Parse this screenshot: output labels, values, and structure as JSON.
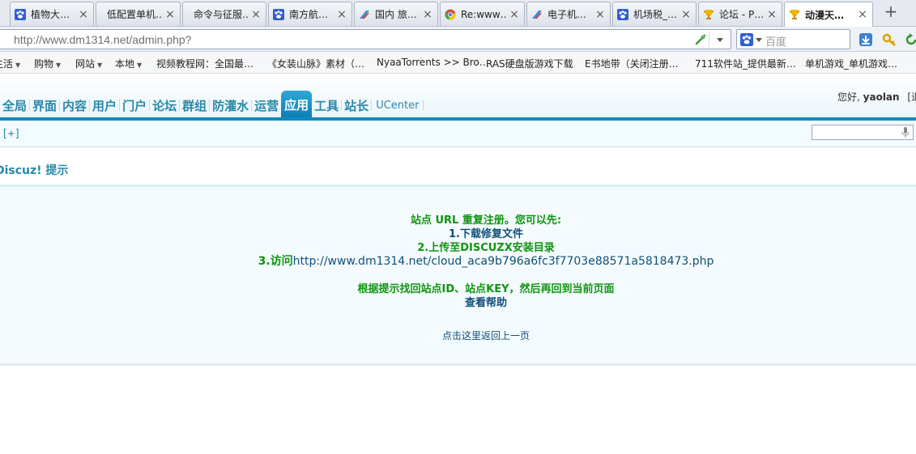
{
  "browser": {
    "tabs": [
      {
        "label": "植物大…",
        "icon": "baidu-paw-icon",
        "active": false
      },
      {
        "label": "低配置单机…",
        "icon": "blank-page-icon",
        "active": false
      },
      {
        "label": "命令与征服…",
        "icon": "blank-page-icon",
        "active": false
      },
      {
        "label": "南方航…",
        "icon": "baidu-paw-icon",
        "active": false
      },
      {
        "label": "国内 旅…",
        "icon": "airline-icon",
        "active": false
      },
      {
        "label": "Re:www…",
        "icon": "chrome-icon",
        "active": false
      },
      {
        "label": "电子机…",
        "icon": "airline-icon",
        "active": false
      },
      {
        "label": "机场税_…",
        "icon": "baidu-paw-icon",
        "active": false
      },
      {
        "label": "论坛 - P…",
        "icon": "trophy-icon",
        "active": false
      },
      {
        "label": "动漫天…",
        "icon": "trophy-icon",
        "active": true
      }
    ],
    "close_glyph": "×",
    "new_tab_glyph": "+",
    "url": "http://www.dm1314.net/admin.php?",
    "search_placeholder": "百度",
    "bookmarks": [
      {
        "label": "生活",
        "has_menu": true
      },
      {
        "label": "购物",
        "has_menu": true
      },
      {
        "label": "网站",
        "has_menu": true
      },
      {
        "label": "本地",
        "has_menu": true
      },
      {
        "label": "视频教程网：全国最…",
        "has_menu": false
      },
      {
        "label": "《女装山脉》素材（…",
        "has_menu": false
      },
      {
        "label": "NyaaTorrents >> Bro…",
        "has_menu": false
      },
      {
        "label": "RAS硬盘版游戏下载",
        "has_menu": false
      },
      {
        "label": "E书地带（关闭注册…",
        "has_menu": false
      },
      {
        "label": "711软件站_提供最新…",
        "has_menu": false
      },
      {
        "label": "单机游戏_单机游戏…",
        "has_menu": false
      }
    ]
  },
  "admin": {
    "nav": [
      {
        "label": "全局",
        "active": false
      },
      {
        "label": "界面",
        "active": false
      },
      {
        "label": "内容",
        "active": false
      },
      {
        "label": "用户",
        "active": false
      },
      {
        "label": "门户",
        "active": false
      },
      {
        "label": "论坛",
        "active": false
      },
      {
        "label": "群组",
        "active": false
      },
      {
        "label": "防灌水",
        "active": false
      },
      {
        "label": "运营",
        "active": false
      },
      {
        "label": "应用",
        "active": true
      },
      {
        "label": "工具",
        "active": false
      },
      {
        "label": "站长",
        "active": false
      },
      {
        "label": "UCenter",
        "active": false
      }
    ],
    "greeting_prefix": "您好,",
    "username": "yaolan",
    "greeting_suffix": "[退",
    "expand_label": "[+]",
    "search_value": ""
  },
  "tip": {
    "title": "Discuz! 提示",
    "line1": "站点 URL 重复注册。您可以先:",
    "step1": "1.下载修复文件",
    "step2": "2.上传至DISCUZX安装目录",
    "step3_lead": "3.访问",
    "step3_url": "http://www.dm1314.net/cloud_aca9b796a6fc3f7703e88571a5818473.php",
    "line_id": "根据提示找回站点ID、站点KEY，然后再回到当前页面",
    "help": "查看帮助",
    "back": "点击这里返回上一页"
  },
  "colors": {
    "accent": "#0e8bc2",
    "tip_green": "#109410",
    "tip_navy": "#10507a"
  }
}
